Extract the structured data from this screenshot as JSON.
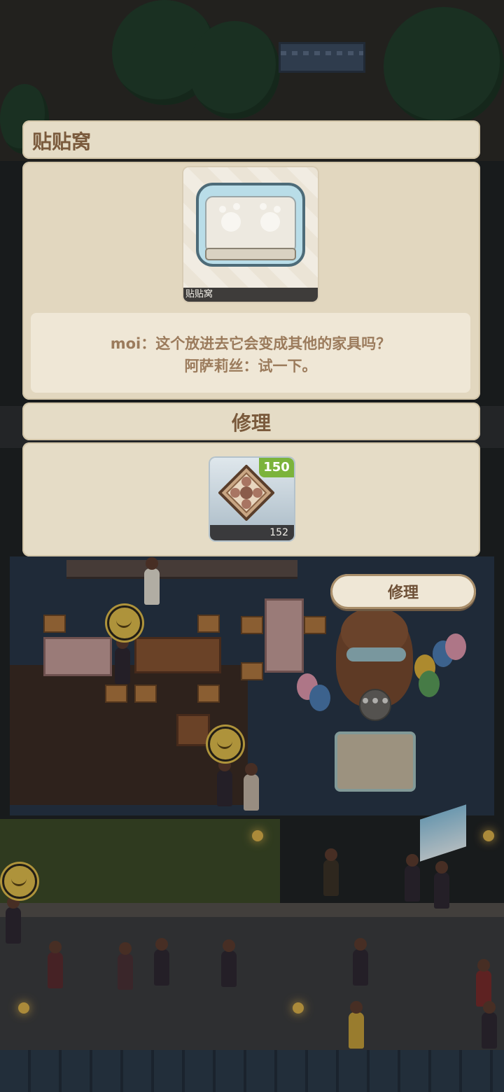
{
  "dialog": {
    "title": "贴贴窝",
    "item": {
      "name": "贴贴窝",
      "icon": "sofa-icon"
    },
    "dialogue_lines": [
      "moi：这个放进去它会变成其他的家具吗？",
      "阿萨莉丝：试一下。"
    ],
    "section_title": "修理",
    "materials": [
      {
        "icon": "repair-material-icon",
        "required": "150",
        "owned": "152"
      }
    ],
    "action_button_label": "修理"
  },
  "colors": {
    "panel": "#e5dcc6",
    "title_text": "#7a5a3c",
    "dialogue_text": "#9b7b5c",
    "badge_green": "#7bb33b"
  }
}
